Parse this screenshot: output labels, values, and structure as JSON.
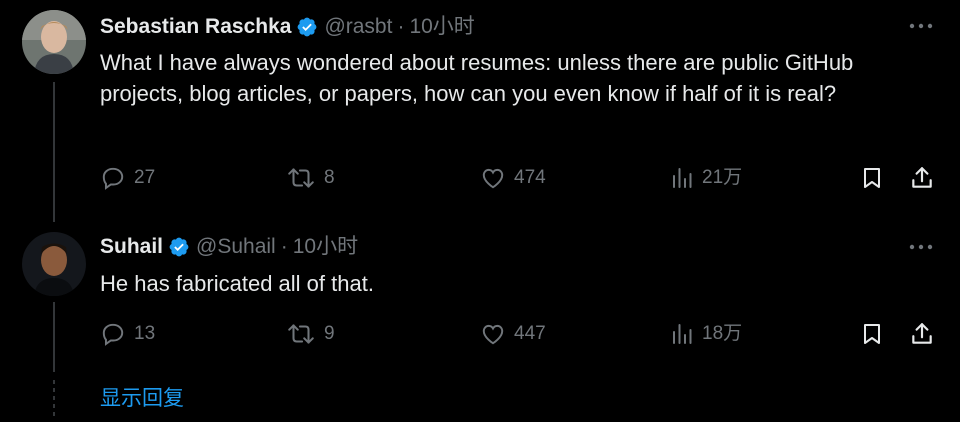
{
  "posts": [
    {
      "name": "Sebastian Raschka",
      "handle": "@rasbt",
      "separator": "·",
      "time": "10小时",
      "text": "What I have always wondered about resumes: unless there are public GitHub projects, blog articles, or papers, how can you even know if half of it is real?",
      "replies": "27",
      "reposts": "8",
      "likes": "474",
      "views": "21万",
      "avatar_bg": "#8a8f8c"
    },
    {
      "name": "Suhail",
      "handle": "@Suhail",
      "separator": "·",
      "time": "10小时",
      "text": "He has fabricated all of that.",
      "replies": "13",
      "reposts": "9",
      "likes": "447",
      "views": "18万",
      "avatar_bg": "#1a1d22"
    }
  ],
  "show_replies_label": "显示回复",
  "colors": {
    "background": "#000000",
    "text": "#e7e9ea",
    "muted": "#71767b",
    "accent": "#1d9bf0",
    "verified": "#1d9bf0",
    "thread_line": "#333639"
  },
  "icons": {
    "verified": "verified-badge-icon",
    "more": "more-horizontal-icon",
    "reply": "reply-icon",
    "repost": "repost-icon",
    "like": "heart-icon",
    "views": "views-chart-icon",
    "bookmark": "bookmark-icon",
    "share": "share-icon"
  }
}
